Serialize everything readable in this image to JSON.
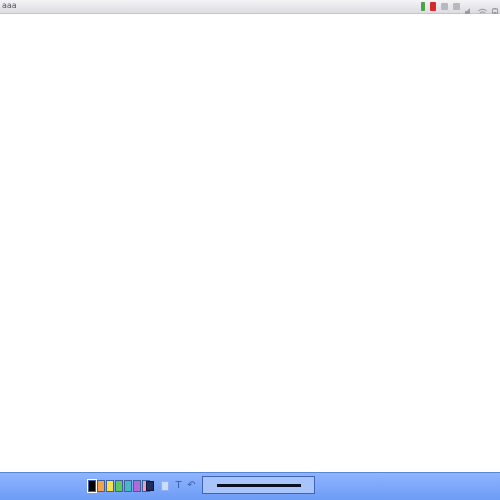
{
  "menubar": {
    "title": "aaa",
    "tray_icons": [
      "status-green-icon",
      "status-red-icon",
      "grey-app-icon",
      "grey-app-icon-2",
      "volume-icon",
      "wifi-icon",
      "battery-icon"
    ]
  },
  "toolbar": {
    "palette": [
      "#000000",
      "#f2a24a",
      "#f5e14a",
      "#5ec65e",
      "#4ab6c8",
      "#b26ad8",
      "#e6a0c8"
    ],
    "selected_color": "#000000",
    "text_tool_glyph": "T",
    "undo_glyph": "↶",
    "pen_icon": "pen-icon",
    "thickness_line_color": "#0b1020"
  },
  "colors": {
    "toolbar_bg": "#7aa6fb",
    "menubar_bg": "#e8e8ee",
    "canvas_bg": "#ffffff"
  }
}
